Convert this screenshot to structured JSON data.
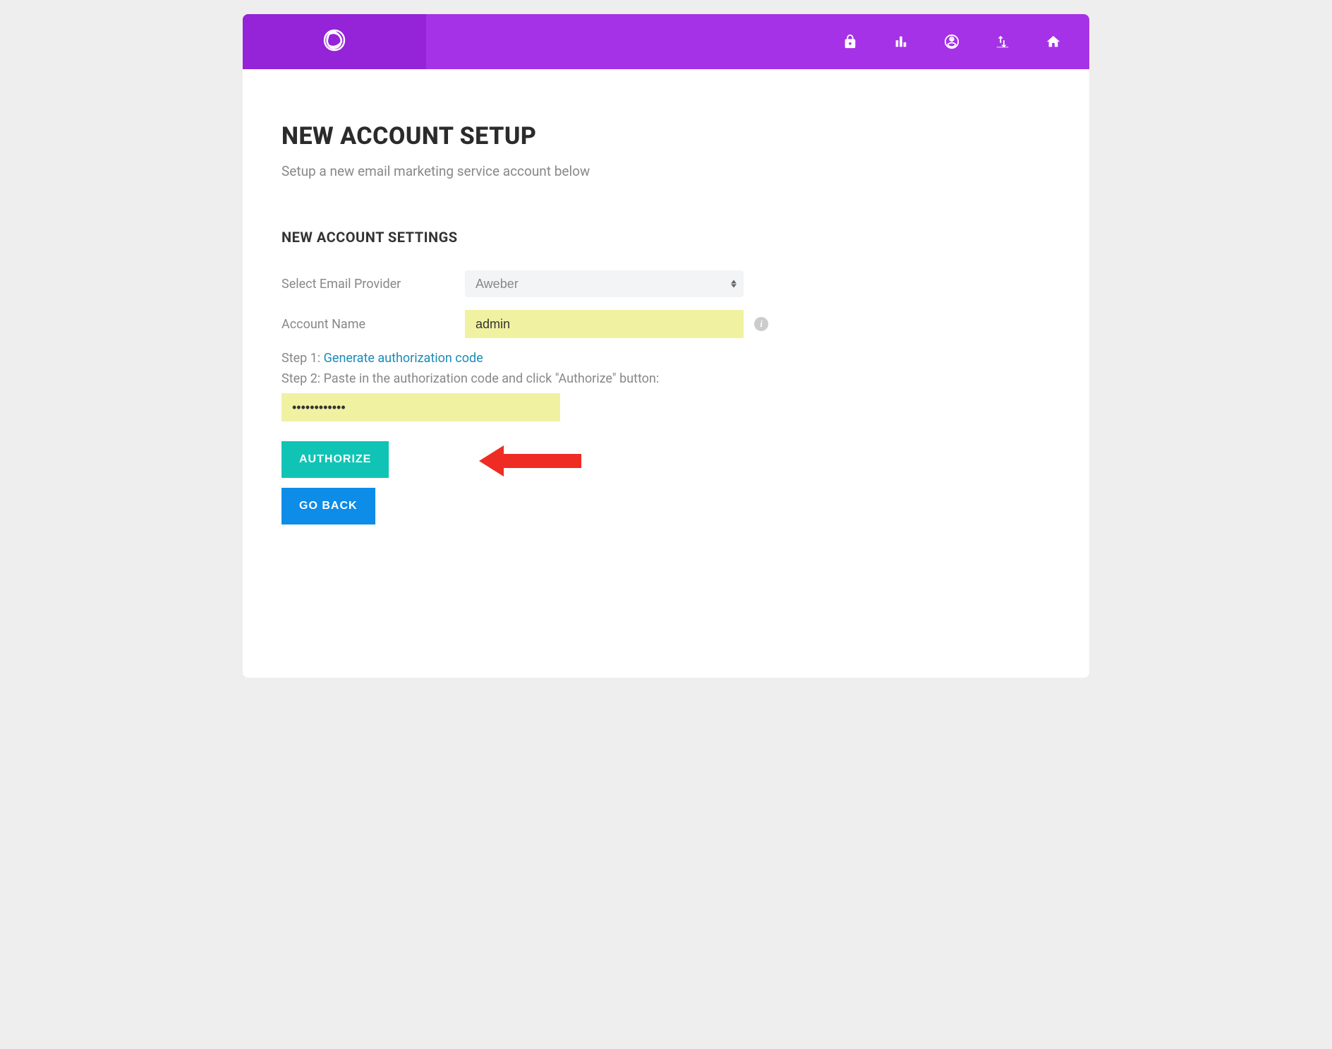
{
  "page": {
    "title": "NEW ACCOUNT SETUP",
    "subtitle": "Setup a new email marketing service account below"
  },
  "section": {
    "title": "NEW ACCOUNT SETTINGS"
  },
  "form": {
    "provider_label": "Select Email Provider",
    "provider_value": "Aweber",
    "account_name_label": "Account Name",
    "account_name_value": "admin",
    "step1_prefix": "Step 1: ",
    "step1_link": "Generate authorization code",
    "step2_text": "Step 2: Paste in the authorization code and click \"Authorize\" button:",
    "auth_code_value": "••••••••••••"
  },
  "buttons": {
    "authorize": "AUTHORIZE",
    "go_back": "GO BACK"
  },
  "colors": {
    "header_bg": "#a532e6",
    "logo_bg": "#9523d8",
    "authorize_btn": "#10c4b5",
    "goback_btn": "#0d8ce8",
    "input_highlight": "#f1f2a1",
    "arrow": "#ee2c24"
  }
}
